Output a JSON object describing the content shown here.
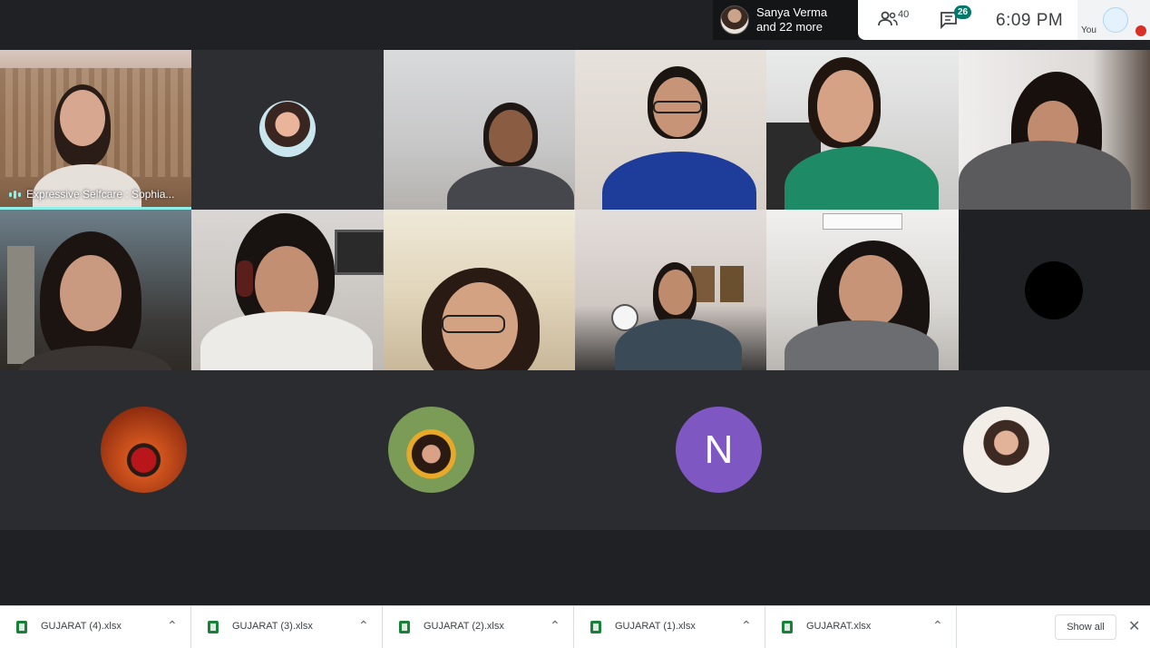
{
  "header": {
    "presenter": {
      "name": "Sanya Verma",
      "more": "and 22 more"
    },
    "participants_count": "40",
    "chat_badge": "26",
    "time": "6:09 PM",
    "self_label": "You"
  },
  "grid": {
    "active_speaker_label": "Expressive Selfcare : Sophia..."
  },
  "avatars": {
    "letter_avatar": "N"
  },
  "colors": {
    "meet_dark": "#202124",
    "speaking_accent": "#8ef0e8",
    "letter_avatar_bg": "#7e57c2",
    "chat_badge_bg": "#00796b",
    "excel_green": "#188038"
  },
  "downloads": {
    "items": [
      {
        "name": "GUJARAT (4).xlsx"
      },
      {
        "name": "GUJARAT (3).xlsx"
      },
      {
        "name": "GUJARAT (2).xlsx"
      },
      {
        "name": "GUJARAT (1).xlsx"
      },
      {
        "name": "GUJARAT.xlsx"
      }
    ],
    "show_all": "Show all"
  }
}
